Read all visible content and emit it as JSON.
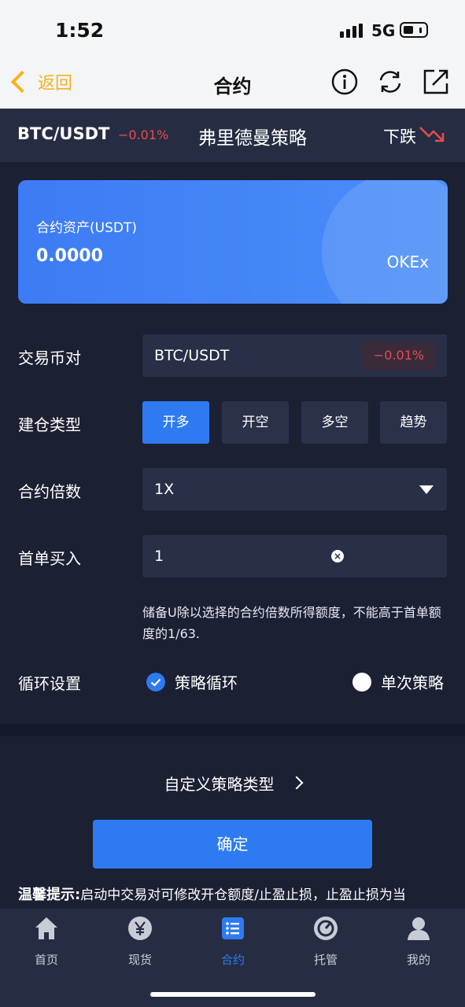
{
  "status_bar": {
    "time": "1:52",
    "network": "5G"
  },
  "nav": {
    "back_label": "返回",
    "title": "合约"
  },
  "strategy_header": {
    "pair": "BTC/USDT",
    "change": "−0.01%",
    "strategy_name": "弗里德曼策略",
    "trend_label": "下跌"
  },
  "asset_card": {
    "label": "合约资产(USDT)",
    "amount": "0.0000",
    "exchange": "OKEx"
  },
  "form": {
    "pair_label": "交易币对",
    "pair_value": "BTC/USDT",
    "pair_change": "−0.01%",
    "position_type_label": "建仓类型",
    "position_types": [
      "开多",
      "开空",
      "多空",
      "趋势"
    ],
    "position_type_selected": "开多",
    "leverage_label": "合约倍数",
    "leverage_value": "1X",
    "first_order_label": "首单买入",
    "first_order_value": "1",
    "hint": "储备U除以选择的合约倍数所得额度，不能高于首单额度的1/63.",
    "cycle_label": "循环设置",
    "cycle_options": [
      "策略循环",
      "单次策略"
    ],
    "cycle_selected": "策略循环"
  },
  "custom_strategy": "自定义策略类型",
  "confirm_label": "确定",
  "tip": {
    "title": "温馨提示:",
    "text": "启动中交易对可修改开仓额度/止盈止损，止盈止损为当"
  },
  "tabs": [
    {
      "label": "首页",
      "icon": "home-icon"
    },
    {
      "label": "现货",
      "icon": "yen-coin-icon"
    },
    {
      "label": "合约",
      "icon": "list-icon"
    },
    {
      "label": "托管",
      "icon": "custody-icon"
    },
    {
      "label": "我的",
      "icon": "user-icon"
    }
  ],
  "active_tab": "合约",
  "colors": {
    "accent": "#2e7bf1",
    "negative": "#e84a52",
    "back": "#f5b21b",
    "bg": "#1b2033"
  }
}
